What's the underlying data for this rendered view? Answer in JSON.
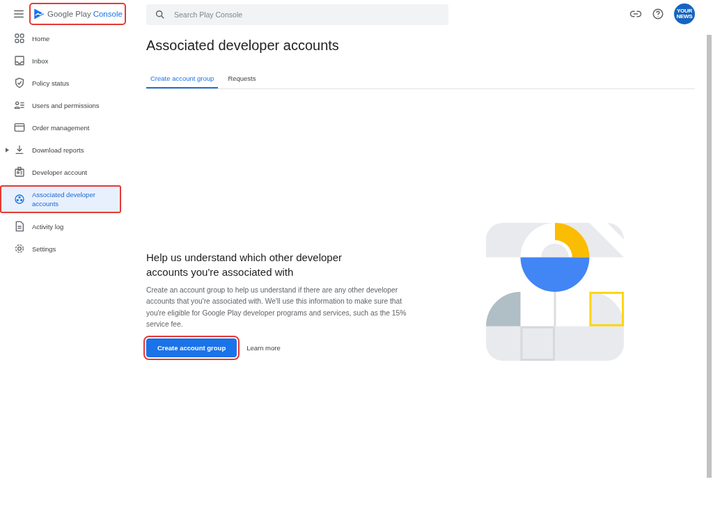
{
  "header": {
    "logo": {
      "brand": "Google Play",
      "product": "Console",
      "highlighted": true
    },
    "search": {
      "placeholder": "Search Play Console"
    },
    "avatar": {
      "text": "YOUR NEWS"
    }
  },
  "sidebar": {
    "items": [
      {
        "label": "Home",
        "selected": false,
        "expandable": false,
        "highlighted": false
      },
      {
        "label": "Inbox",
        "selected": false,
        "expandable": false,
        "highlighted": false
      },
      {
        "label": "Policy status",
        "selected": false,
        "expandable": false,
        "highlighted": false
      },
      {
        "label": "Users and permissions",
        "selected": false,
        "expandable": false,
        "highlighted": false
      },
      {
        "label": "Order management",
        "selected": false,
        "expandable": false,
        "highlighted": false
      },
      {
        "label": "Download reports",
        "selected": false,
        "expandable": true,
        "highlighted": false
      },
      {
        "label": "Developer account",
        "selected": false,
        "expandable": false,
        "highlighted": false
      },
      {
        "label": "Associated developer accounts",
        "selected": true,
        "expandable": false,
        "highlighted": true
      },
      {
        "label": "Activity log",
        "selected": false,
        "expandable": false,
        "highlighted": false
      },
      {
        "label": "Settings",
        "selected": false,
        "expandable": false,
        "highlighted": false
      }
    ]
  },
  "page": {
    "title": "Associated developer accounts",
    "tabs": [
      {
        "label": "Create account group",
        "selected": true
      },
      {
        "label": "Requests",
        "selected": false
      }
    ],
    "empty_state": {
      "heading": "Help us understand which other developer accounts you're associated with",
      "body": "Create an account group to help us understand if there are any other developer accounts that you're associated with. We'll use this information to make sure that you're eligible for Google Play developer programs and services, such as the 15% service fee.",
      "primary_button": {
        "label": "Create account group",
        "highlighted": true
      },
      "link": "Learn more"
    }
  }
}
